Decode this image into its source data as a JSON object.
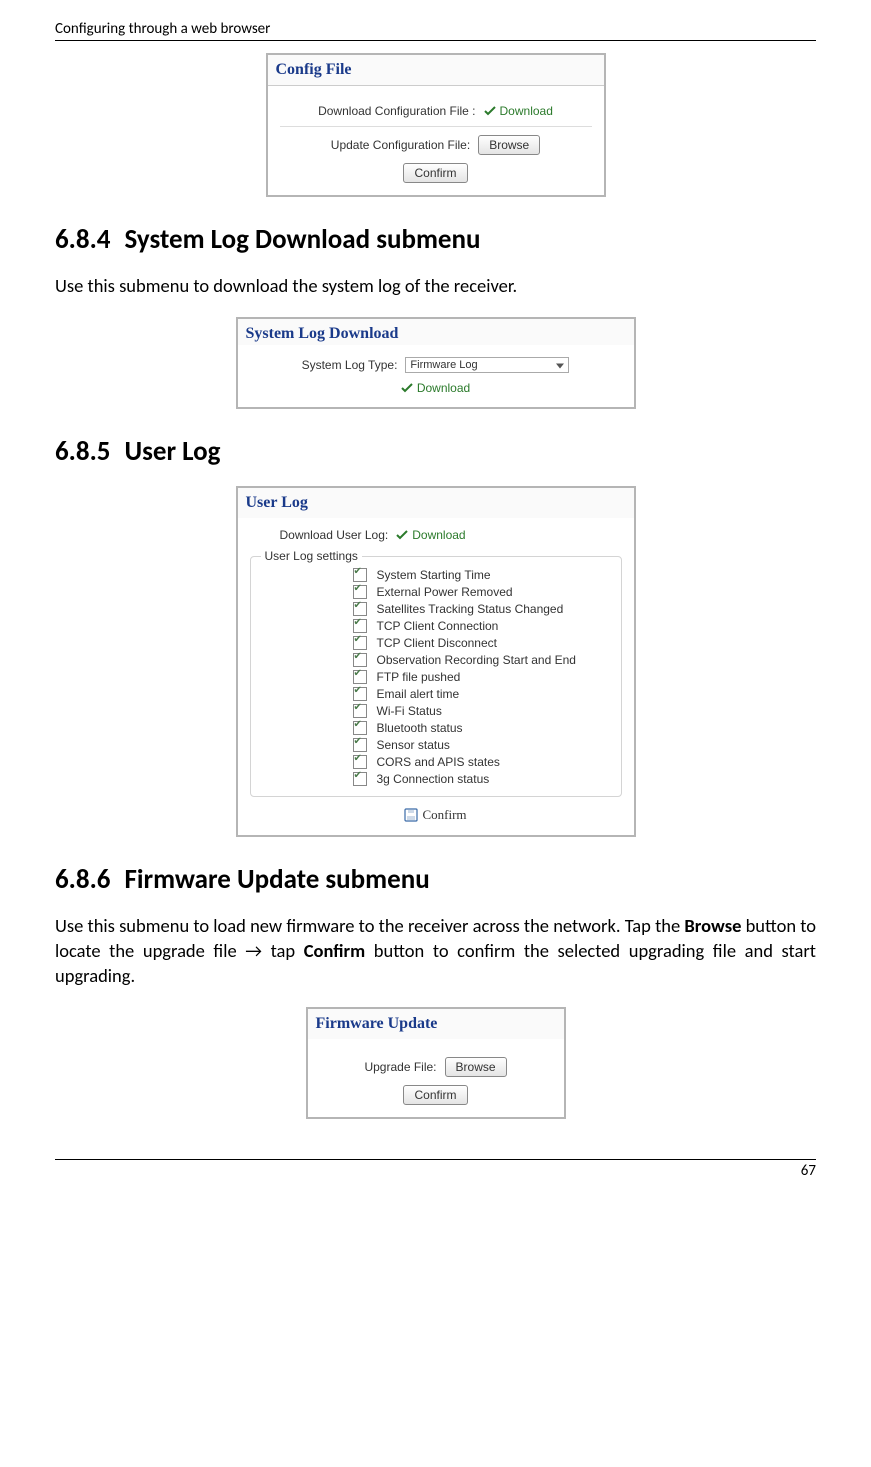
{
  "page": {
    "header": "Configuring through a web browser",
    "footer_page": "67"
  },
  "fig_config": {
    "title": "Config File",
    "download_label": "Download Configuration File :",
    "download_link": "Download",
    "update_label": "Update Configuration File:",
    "browse_btn": "Browse",
    "confirm_btn": "Confirm"
  },
  "sec684": {
    "num": "6.8.4",
    "title": "System Log Download submenu",
    "body": "Use this submenu to download the system log of the receiver."
  },
  "fig_syslog": {
    "title": "System Log Download",
    "type_label": "System Log Type:",
    "type_value": "Firmware Log",
    "download_link": "Download"
  },
  "sec685": {
    "num": "6.8.5",
    "title": "User Log"
  },
  "fig_userlog": {
    "title": "User Log",
    "download_label": "Download User Log:",
    "download_link": "Download",
    "settings_label": "User Log settings",
    "items": [
      "System Starting Time",
      "External Power Removed",
      "Satellites Tracking Status Changed",
      "TCP Client Connection",
      "TCP Client Disconnect",
      "Observation Recording Start and End",
      "FTP file pushed",
      "Email alert time",
      "Wi-Fi Status",
      "Bluetooth status",
      "Sensor status",
      "CORS and APIS states",
      "3g Connection status"
    ],
    "confirm": "Confirm"
  },
  "sec686": {
    "num": "6.8.6",
    "title": "Firmware Update submenu",
    "body_pre": "Use this submenu to load new firmware to the receiver across the network. Tap the ",
    "body_b1": "Browse",
    "body_mid": " button to locate the upgrade file → tap ",
    "body_b2": "Confirm",
    "body_post": " button to confirm the selected upgrading file and start upgrading."
  },
  "fig_fw": {
    "title": "Firmware Update",
    "upgrade_label": "Upgrade File:",
    "browse_btn": "Browse",
    "confirm_btn": "Confirm"
  }
}
